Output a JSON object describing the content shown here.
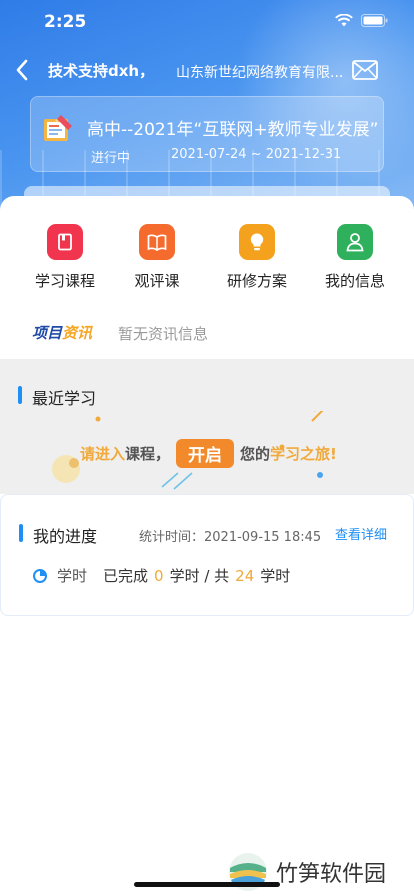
{
  "status_bar": {
    "time": "2:25"
  },
  "nav": {
    "title": "技术支持dxh，",
    "subtitle": "山东新世纪网络教育有限..."
  },
  "project": {
    "title": "高中--2021年“互联网+教师专业发展”",
    "status": "进行中",
    "dates": "2021-07-24 ~ 2021-12-31"
  },
  "menu": [
    {
      "label": "学习课程",
      "icon": "book-icon",
      "color": "#f2354e"
    },
    {
      "label": "观评课",
      "icon": "open-book-icon",
      "color": "#f46b2d"
    },
    {
      "label": "研修方案",
      "icon": "lightbulb-icon",
      "color": "#f4a21d"
    },
    {
      "label": "我的信息",
      "icon": "user-icon",
      "color": "#2eb05c"
    }
  ],
  "news": {
    "logo_a": "项目",
    "logo_b": "资讯",
    "text": "暂无资讯信息"
  },
  "recent": {
    "title": "最近学习",
    "banner_a": "请进入",
    "banner_b": "课程，",
    "banner_pill": "开启",
    "banner_c": "您的",
    "banner_d": "学习之旅!"
  },
  "progress": {
    "title": "我的进度",
    "stat_time": "统计时间：2021-09-15 18:45",
    "detail": "查看详细",
    "unit_label": "学时",
    "done_label": "已完成",
    "done": "0",
    "done_unit": "学时 / 共",
    "total": "24",
    "total_unit": "学时"
  },
  "watermark": {
    "text": "竹笋软件园"
  },
  "colors": {
    "primary": "#2f7ce8",
    "accent": "#1f8ff5",
    "orange": "#f0a93a"
  }
}
